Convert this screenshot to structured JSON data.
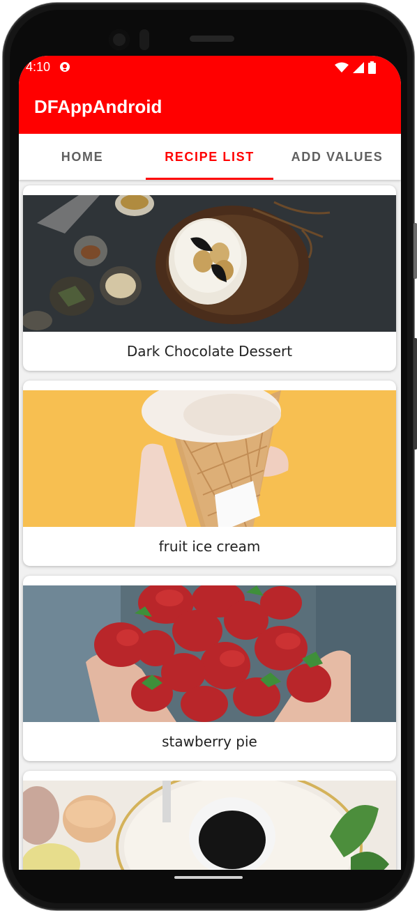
{
  "status": {
    "time": "4:10",
    "icons": [
      "notification-icon",
      "wifi-icon",
      "signal-icon",
      "battery-icon"
    ]
  },
  "app": {
    "title": "DFAppAndroid",
    "accent_color": "#ff0000"
  },
  "tabs": [
    {
      "label": "HOME",
      "active": false
    },
    {
      "label": "RECIPE LIST",
      "active": true
    },
    {
      "label": "ADD VALUES",
      "active": false
    }
  ],
  "recipes": [
    {
      "name": "Dark Chocolate Dessert",
      "image": "dessert-photo"
    },
    {
      "name": "fruit ice cream",
      "image": "ice-cream-cone-photo"
    },
    {
      "name": "stawberry pie",
      "image": "strawberries-photo"
    },
    {
      "name": "",
      "image": "macarons-coffee-photo"
    }
  ]
}
